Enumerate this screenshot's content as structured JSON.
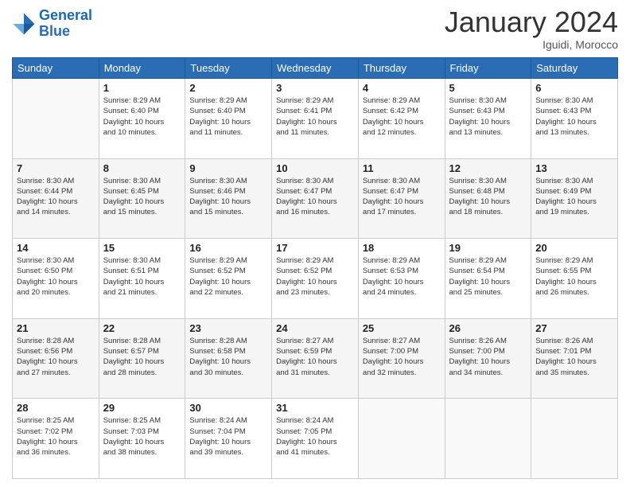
{
  "logo": {
    "line1": "General",
    "line2": "Blue"
  },
  "title": "January 2024",
  "location": "Iguidi, Morocco",
  "days_header": [
    "Sunday",
    "Monday",
    "Tuesday",
    "Wednesday",
    "Thursday",
    "Friday",
    "Saturday"
  ],
  "weeks": [
    {
      "days": [
        {
          "num": "",
          "info": ""
        },
        {
          "num": "1",
          "info": "Sunrise: 8:29 AM\nSunset: 6:40 PM\nDaylight: 10 hours\nand 10 minutes."
        },
        {
          "num": "2",
          "info": "Sunrise: 8:29 AM\nSunset: 6:40 PM\nDaylight: 10 hours\nand 11 minutes."
        },
        {
          "num": "3",
          "info": "Sunrise: 8:29 AM\nSunset: 6:41 PM\nDaylight: 10 hours\nand 11 minutes."
        },
        {
          "num": "4",
          "info": "Sunrise: 8:29 AM\nSunset: 6:42 PM\nDaylight: 10 hours\nand 12 minutes."
        },
        {
          "num": "5",
          "info": "Sunrise: 8:30 AM\nSunset: 6:43 PM\nDaylight: 10 hours\nand 13 minutes."
        },
        {
          "num": "6",
          "info": "Sunrise: 8:30 AM\nSunset: 6:43 PM\nDaylight: 10 hours\nand 13 minutes."
        }
      ]
    },
    {
      "days": [
        {
          "num": "7",
          "info": "Sunrise: 8:30 AM\nSunset: 6:44 PM\nDaylight: 10 hours\nand 14 minutes."
        },
        {
          "num": "8",
          "info": "Sunrise: 8:30 AM\nSunset: 6:45 PM\nDaylight: 10 hours\nand 15 minutes."
        },
        {
          "num": "9",
          "info": "Sunrise: 8:30 AM\nSunset: 6:46 PM\nDaylight: 10 hours\nand 15 minutes."
        },
        {
          "num": "10",
          "info": "Sunrise: 8:30 AM\nSunset: 6:47 PM\nDaylight: 10 hours\nand 16 minutes."
        },
        {
          "num": "11",
          "info": "Sunrise: 8:30 AM\nSunset: 6:47 PM\nDaylight: 10 hours\nand 17 minutes."
        },
        {
          "num": "12",
          "info": "Sunrise: 8:30 AM\nSunset: 6:48 PM\nDaylight: 10 hours\nand 18 minutes."
        },
        {
          "num": "13",
          "info": "Sunrise: 8:30 AM\nSunset: 6:49 PM\nDaylight: 10 hours\nand 19 minutes."
        }
      ]
    },
    {
      "days": [
        {
          "num": "14",
          "info": "Sunrise: 8:30 AM\nSunset: 6:50 PM\nDaylight: 10 hours\nand 20 minutes."
        },
        {
          "num": "15",
          "info": "Sunrise: 8:30 AM\nSunset: 6:51 PM\nDaylight: 10 hours\nand 21 minutes."
        },
        {
          "num": "16",
          "info": "Sunrise: 8:29 AM\nSunset: 6:52 PM\nDaylight: 10 hours\nand 22 minutes."
        },
        {
          "num": "17",
          "info": "Sunrise: 8:29 AM\nSunset: 6:52 PM\nDaylight: 10 hours\nand 23 minutes."
        },
        {
          "num": "18",
          "info": "Sunrise: 8:29 AM\nSunset: 6:53 PM\nDaylight: 10 hours\nand 24 minutes."
        },
        {
          "num": "19",
          "info": "Sunrise: 8:29 AM\nSunset: 6:54 PM\nDaylight: 10 hours\nand 25 minutes."
        },
        {
          "num": "20",
          "info": "Sunrise: 8:29 AM\nSunset: 6:55 PM\nDaylight: 10 hours\nand 26 minutes."
        }
      ]
    },
    {
      "days": [
        {
          "num": "21",
          "info": "Sunrise: 8:28 AM\nSunset: 6:56 PM\nDaylight: 10 hours\nand 27 minutes."
        },
        {
          "num": "22",
          "info": "Sunrise: 8:28 AM\nSunset: 6:57 PM\nDaylight: 10 hours\nand 28 minutes."
        },
        {
          "num": "23",
          "info": "Sunrise: 8:28 AM\nSunset: 6:58 PM\nDaylight: 10 hours\nand 30 minutes."
        },
        {
          "num": "24",
          "info": "Sunrise: 8:27 AM\nSunset: 6:59 PM\nDaylight: 10 hours\nand 31 minutes."
        },
        {
          "num": "25",
          "info": "Sunrise: 8:27 AM\nSunset: 7:00 PM\nDaylight: 10 hours\nand 32 minutes."
        },
        {
          "num": "26",
          "info": "Sunrise: 8:26 AM\nSunset: 7:00 PM\nDaylight: 10 hours\nand 34 minutes."
        },
        {
          "num": "27",
          "info": "Sunrise: 8:26 AM\nSunset: 7:01 PM\nDaylight: 10 hours\nand 35 minutes."
        }
      ]
    },
    {
      "days": [
        {
          "num": "28",
          "info": "Sunrise: 8:25 AM\nSunset: 7:02 PM\nDaylight: 10 hours\nand 36 minutes."
        },
        {
          "num": "29",
          "info": "Sunrise: 8:25 AM\nSunset: 7:03 PM\nDaylight: 10 hours\nand 38 minutes."
        },
        {
          "num": "30",
          "info": "Sunrise: 8:24 AM\nSunset: 7:04 PM\nDaylight: 10 hours\nand 39 minutes."
        },
        {
          "num": "31",
          "info": "Sunrise: 8:24 AM\nSunset: 7:05 PM\nDaylight: 10 hours\nand 41 minutes."
        },
        {
          "num": "",
          "info": ""
        },
        {
          "num": "",
          "info": ""
        },
        {
          "num": "",
          "info": ""
        }
      ]
    }
  ]
}
